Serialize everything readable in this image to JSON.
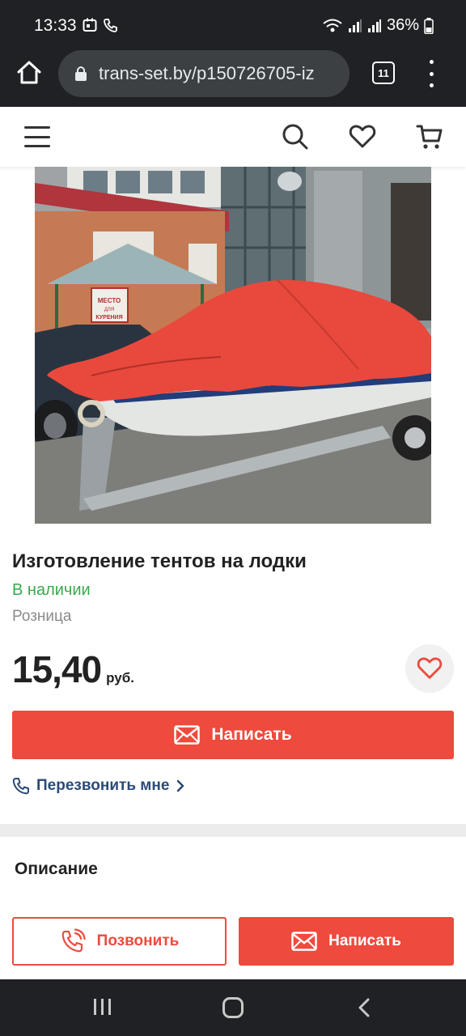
{
  "status_bar": {
    "time": "13:33",
    "battery": "36%"
  },
  "browser": {
    "url": "trans-set.by/p150726705-iz",
    "tab_count": "11"
  },
  "product": {
    "title": "Изготовление тентов на лодки",
    "availability": "В наличии",
    "sale_type": "Розница",
    "price": "15,40",
    "currency": "руб.",
    "image_sign_text": "МЕСТО ДЛЯ КУРЕНИЯ"
  },
  "actions": {
    "write_label": "Написать",
    "callback_label": "Перезвонить мне",
    "call_label": "Позвонить",
    "write_bottom_label": "Написать"
  },
  "description": {
    "title": "Описание"
  },
  "colors": {
    "accent": "#ee4a3e",
    "availability_green": "#3aa84d",
    "link_blue": "#2a4a78",
    "browser_chrome": "#202124"
  }
}
